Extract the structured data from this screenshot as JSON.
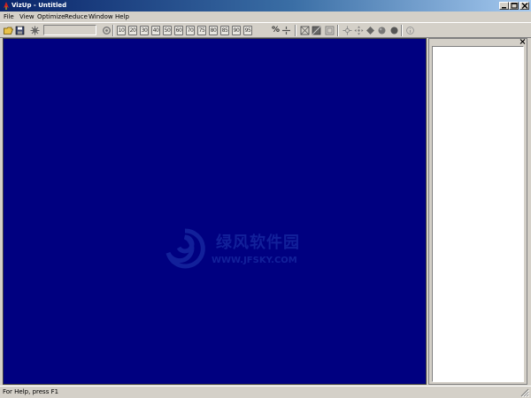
{
  "window": {
    "title": "VizUp - Untitled",
    "controls": [
      "minimize",
      "maximize",
      "close"
    ]
  },
  "menubar": {
    "items": [
      "File",
      "View",
      "Optimize",
      "Reduce",
      "Window",
      "Help"
    ]
  },
  "toolbar": {
    "buttons": [
      "open-folder-icon",
      "save-icon",
      "settings-icon",
      "refresh-icon"
    ],
    "input_value": "",
    "percent_labels": [
      "10",
      "20",
      "30",
      "40",
      "50",
      "60",
      "70",
      "75",
      "80",
      "85",
      "90",
      "95"
    ],
    "percent_symbol": "%"
  },
  "canvas": {
    "background": "#000080",
    "watermark_cn": "绿风软件园",
    "watermark_url": "WWW.JFSKY.COM"
  },
  "statusbar": {
    "text": "For Help, press F1"
  },
  "colors": {
    "title_start": "#0a246a",
    "title_end": "#a6caf0",
    "face": "#d4d0c8",
    "canvas": "#000080"
  }
}
